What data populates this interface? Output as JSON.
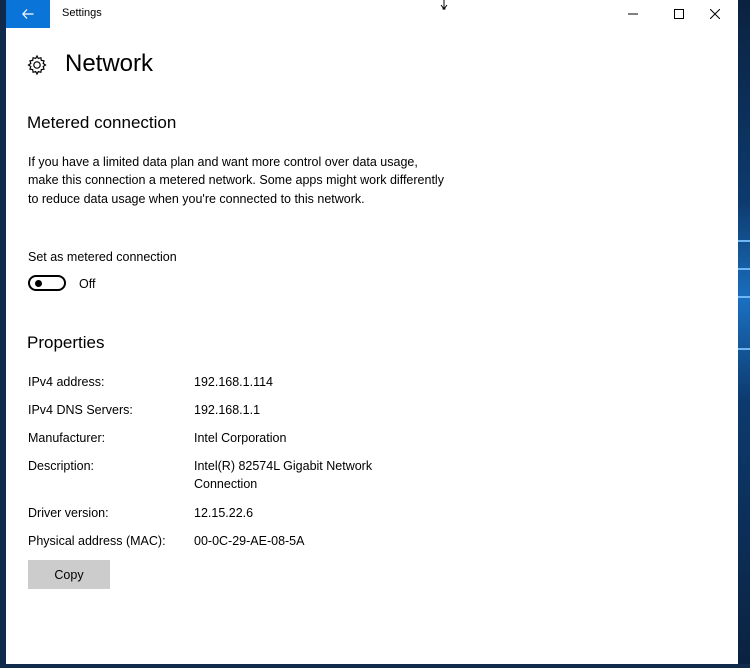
{
  "window": {
    "app_title": "Settings"
  },
  "page": {
    "title": "Network",
    "icon": "gear-icon"
  },
  "metered": {
    "heading": "Metered connection",
    "description": "If you have a limited data plan and want more control over data usage, make this connection a metered network. Some apps might work differently to reduce data usage when you're connected to this network.",
    "toggle_label": "Set as metered connection",
    "toggle_state": "Off",
    "toggle_on": false
  },
  "properties": {
    "heading": "Properties",
    "rows": [
      {
        "label": "IPv4 address:",
        "value": "192.168.1.114"
      },
      {
        "label": "IPv4 DNS Servers:",
        "value": "192.168.1.1"
      },
      {
        "label": "Manufacturer:",
        "value": "Intel Corporation"
      },
      {
        "label": "Description:",
        "value": "Intel(R) 82574L Gigabit Network Connection"
      },
      {
        "label": "Driver version:",
        "value": "12.15.22.6"
      },
      {
        "label": "Physical address (MAC):",
        "value": "00-0C-29-AE-08-5A"
      }
    ],
    "copy_label": "Copy"
  },
  "colors": {
    "accent": "#0a74d9",
    "button_bg": "#cccccc"
  }
}
